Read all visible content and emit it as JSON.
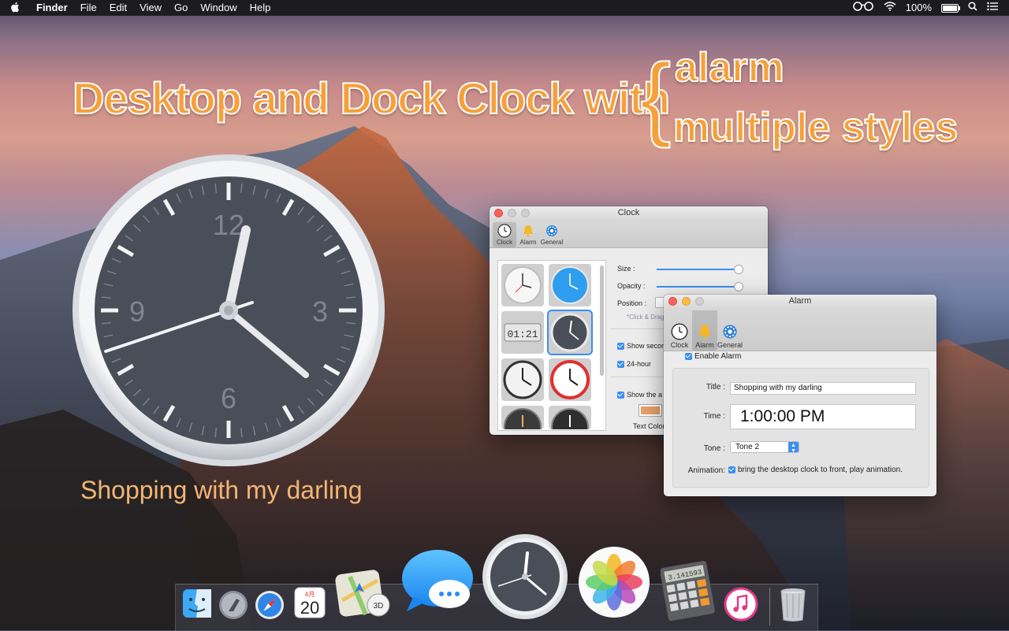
{
  "menubar": {
    "apple": "",
    "app_name": "Finder",
    "menus": [
      "File",
      "Edit",
      "View",
      "Go",
      "Window",
      "Help"
    ],
    "battery_text": "100%",
    "icons": [
      "glasses-icon",
      "wifi-icon",
      "battery-icon",
      "spotlight-icon",
      "notification-center-icon"
    ]
  },
  "headline": {
    "main": "Desktop and Dock Clock with",
    "brace": "{",
    "feature_1": "alarm",
    "feature_2": "multiple styles"
  },
  "desktop_clock": {
    "numerals": [
      "12",
      "3",
      "6",
      "9"
    ],
    "caption": "Shopping with my darling"
  },
  "clock_window": {
    "title": "Clock",
    "tabs": [
      {
        "label": "Clock",
        "icon": "clock-icon",
        "selected": true
      },
      {
        "label": "Alarm",
        "icon": "bell-icon",
        "selected": false
      },
      {
        "label": "General",
        "icon": "gear-icon",
        "selected": false
      }
    ],
    "digital_sample": "01:21",
    "size_label": "Size :",
    "opacity_label": "Opacity :",
    "position_label": "Position :",
    "position_hint": "*Click & Drag",
    "show_seconds": "Show secor",
    "hour24": "24-hour",
    "show_text": "Show the a",
    "text_color_label": "Text Color",
    "text_color": "#e8a06a",
    "size_value": 1.0,
    "opacity_value": 1.0
  },
  "alarm_window": {
    "title": "Alarm",
    "tabs": [
      {
        "label": "Clock",
        "icon": "clock-icon",
        "selected": false
      },
      {
        "label": "Alarm",
        "icon": "bell-icon",
        "selected": true
      },
      {
        "label": "General",
        "icon": "gear-icon",
        "selected": false
      }
    ],
    "enable_label": "Enable Alarm",
    "title_label": "Title :",
    "title_value": "Shopping with my darling",
    "time_label": "Time :",
    "time_value": "1:00:00 PM",
    "tone_label": "Tone :",
    "tone_value": "Tone 2",
    "animation_label": "Animation:",
    "animation_text": "bring the desktop clock to front, play animation."
  },
  "dock": {
    "apps": [
      "finder-icon",
      "launchpad-icon",
      "safari-icon",
      "calendar-icon",
      "maps-icon",
      "messages-icon",
      "clock-app-icon",
      "photos-icon",
      "calculator-icon",
      "itunes-icon",
      "trash-icon"
    ],
    "calendar_month": "4月",
    "calendar_day": "20",
    "maps_badge": "3D",
    "calculator_display": "3.141593"
  },
  "colors": {
    "accent": "#3b8ff1",
    "headline": "#f6a03a",
    "clock_face": "#4b4f5a"
  }
}
